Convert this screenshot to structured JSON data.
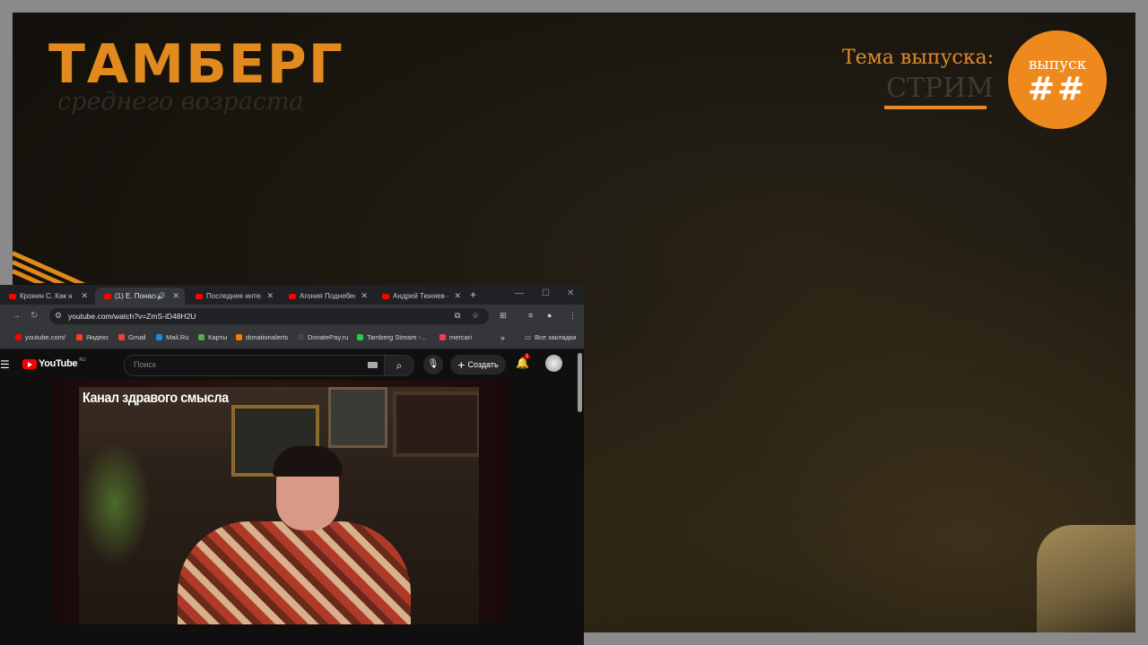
{
  "overlay": {
    "logo_title": "ТАМБЕРГ",
    "logo_subtitle": "среднего возраста",
    "topic_label": "Тема выпуска:",
    "topic_value": "СТРИМ",
    "badge_label": "выпуск",
    "badge_number": "##",
    "accent_color": "#e68a1e"
  },
  "browser": {
    "tabs": [
      {
        "title": "Кронин С. Как н",
        "active": false,
        "audio": false
      },
      {
        "title": "(1) Е. Понасен",
        "active": true,
        "audio": true
      },
      {
        "title": "Последнее интер",
        "active": false,
        "audio": false
      },
      {
        "title": "Агония Поднебес",
        "active": false,
        "audio": false
      },
      {
        "title": "Андрей Тюняев -",
        "active": false,
        "audio": false
      }
    ],
    "new_tab": "+",
    "url": "youtube.com/watch?v=ZmS-iD48H2U",
    "bookmarks": [
      {
        "label": "youtube.com/",
        "color": "#ff0000"
      },
      {
        "label": "Яндекс",
        "color": "#fc3f1d"
      },
      {
        "label": "Gmail",
        "color": "#ea4335"
      },
      {
        "label": "Mail.Ru",
        "color": "#168de2"
      },
      {
        "label": "Карты",
        "color": "#4caf50"
      },
      {
        "label": "donationalerts",
        "color": "#f57c00"
      },
      {
        "label": "DonatePay.ru",
        "color": "#444444"
      },
      {
        "label": "Tamberg Stream -...",
        "color": "#22cc44"
      },
      {
        "label": "mercari",
        "color": "#ff3355"
      }
    ],
    "more_bookmarks": "»",
    "all_bookmarks": "Все закладки"
  },
  "youtube": {
    "logo_text": "YouTube",
    "region": "RU",
    "search_placeholder": "Поиск",
    "create_label": "Создать",
    "notifications": "1",
    "video_title": "Канал здравого смысла"
  }
}
